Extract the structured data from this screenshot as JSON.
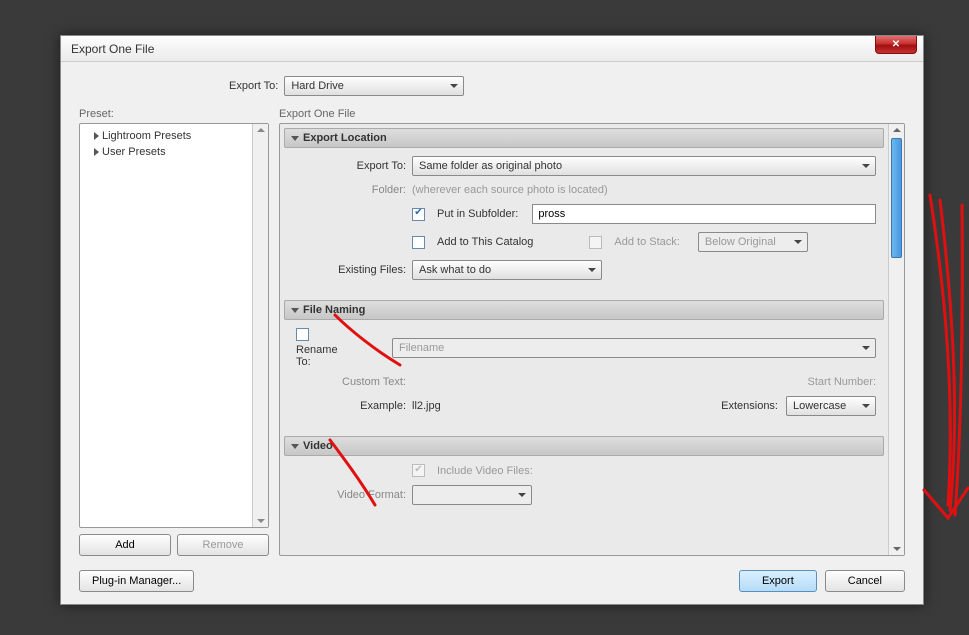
{
  "dialog": {
    "title": "Export One File"
  },
  "topRow": {
    "exportToLabel": "Export To:",
    "exportToValue": "Hard Drive"
  },
  "presetCol": {
    "label": "Preset:",
    "items": [
      "Lightroom Presets",
      "User Presets"
    ],
    "addLabel": "Add",
    "removeLabel": "Remove"
  },
  "mainCol": {
    "label": "Export One File"
  },
  "sections": {
    "exportLocation": {
      "title": "Export Location",
      "exportToLabel": "Export To:",
      "exportToValue": "Same folder as original photo",
      "folderLabel": "Folder:",
      "folderValue": "(wherever each source photo is located)",
      "putInSubfolderLabel": "Put in Subfolder:",
      "subfolderValue": "pross",
      "addToCatalogLabel": "Add to This Catalog",
      "addToStackLabel": "Add to Stack:",
      "stackPositionValue": "Below Original",
      "existingFilesLabel": "Existing Files:",
      "existingFilesValue": "Ask what to do"
    },
    "fileNaming": {
      "title": "File Naming",
      "renameToLabel": "Rename To:",
      "renameToValue": "Filename",
      "customTextLabel": "Custom Text:",
      "startNumberLabel": "Start Number:",
      "exampleLabel": "Example:",
      "exampleValue": "ll2.jpg",
      "extensionsLabel": "Extensions:",
      "extensionsValue": "Lowercase"
    },
    "video": {
      "title": "Video",
      "includeLabel": "Include Video Files:",
      "formatLabel": "Video Format:"
    }
  },
  "footer": {
    "pluginManagerLabel": "Plug-in Manager...",
    "exportLabel": "Export",
    "cancelLabel": "Cancel"
  }
}
